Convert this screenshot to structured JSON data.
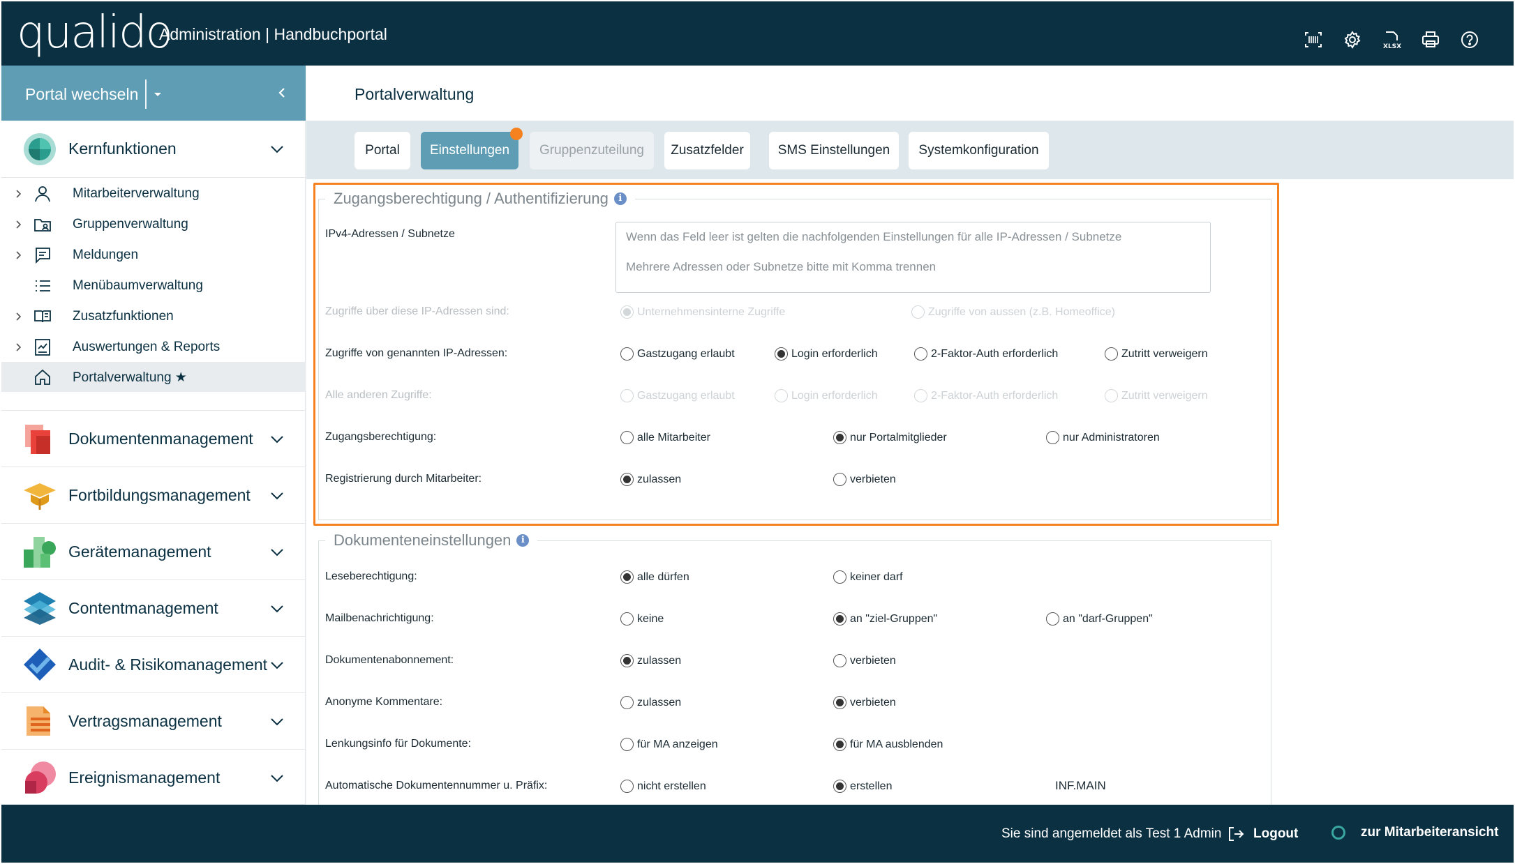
{
  "header": {
    "logo": "qualido",
    "app_title": "Administration | Handbuchportal",
    "icons": [
      "barcode-icon",
      "gear-icon",
      "xlsx-icon",
      "print-icon",
      "help-icon"
    ],
    "xlsx_text": "XLSX"
  },
  "sidebar": {
    "portal_switch": "Portal wechseln",
    "kern": {
      "title": "Kernfunktionen",
      "items": [
        {
          "label": "Mitarbeiterverwaltung",
          "icon": "user-icon",
          "expandable": true
        },
        {
          "label": "Gruppenverwaltung",
          "icon": "group-folder-icon",
          "expandable": true
        },
        {
          "label": "Meldungen",
          "icon": "message-icon",
          "expandable": true
        },
        {
          "label": "Menübaumverwaltung",
          "icon": "list-icon",
          "expandable": false
        },
        {
          "label": "Zusatzfunktionen",
          "icon": "book-icon",
          "expandable": true
        },
        {
          "label": "Auswertungen & Reports",
          "icon": "report-icon",
          "expandable": true
        },
        {
          "label": "Portalverwaltung ★",
          "icon": "home-icon",
          "expandable": false,
          "active": true
        }
      ]
    },
    "sections": [
      {
        "title": "Dokumentenmanagement",
        "icon": "documents-icon"
      },
      {
        "title": "Fortbildungsmanagement",
        "icon": "graduation-icon"
      },
      {
        "title": "Gerätemanagement",
        "icon": "devices-icon"
      },
      {
        "title": "Contentmanagement",
        "icon": "layers-icon"
      },
      {
        "title": "Audit- & Risikomanagement",
        "icon": "checkmark-icon"
      },
      {
        "title": "Vertragsmanagement",
        "icon": "contract-icon"
      },
      {
        "title": "Ereignismanagement",
        "icon": "events-icon"
      }
    ]
  },
  "main": {
    "title": "Portalverwaltung",
    "tabs": [
      {
        "label": "Portal"
      },
      {
        "label": "Einstellungen"
      },
      {
        "label": "Gruppenzuteilung"
      },
      {
        "label": "Zusatzfelder"
      },
      {
        "label": "SMS Einstellungen"
      },
      {
        "label": "Systemkonfiguration"
      }
    ],
    "active_tab": "Einstellungen",
    "access": {
      "legend": "Zugangsberechtigung / Authentifizierung",
      "ip_label": "IPv4-Adressen / Subnetze",
      "ip_placeholder_1": "Wenn das Feld leer ist gelten die nachfolgenden Einstellungen für alle IP-Adressen / Subnetze",
      "ip_placeholder_2": "Mehrere Adressen oder Subnetze bitte mit Komma trennen",
      "rows": {
        "ip_type": {
          "label": "Zugriffe über diese IP-Adressen sind:",
          "options": [
            "Unternehmensinterne Zugriffe",
            "Zugriffe von aussen (z.B. Homeoffice)"
          ],
          "selected": "Unternehmensinterne Zugriffe",
          "disabled": true
        },
        "named_ip": {
          "label": "Zugriffe von genannten IP-Adressen:",
          "options": [
            "Gastzugang erlaubt",
            "Login erforderlich",
            "2-Faktor-Auth erforderlich",
            "Zutritt verweigern"
          ],
          "selected": "Login erforderlich"
        },
        "other": {
          "label": "Alle anderen Zugriffe:",
          "options": [
            "Gastzugang erlaubt",
            "Login erforderlich",
            "2-Faktor-Auth erforderlich",
            "Zutritt verweigern"
          ],
          "disabled": true
        },
        "access_right": {
          "label": "Zugangsberechtigung:",
          "options": [
            "alle Mitarbeiter",
            "nur Portalmitglieder",
            "nur Administratoren"
          ],
          "selected": "nur Portalmitglieder"
        },
        "registration": {
          "label": "Registrierung durch Mitarbeiter:",
          "options": [
            "zulassen",
            "verbieten"
          ],
          "selected": "zulassen"
        }
      }
    },
    "docs": {
      "legend": "Dokumenteneinstellungen",
      "rows": {
        "read": {
          "label": "Leseberechtigung:",
          "options": [
            "alle dürfen",
            "keiner darf"
          ],
          "selected": "alle dürfen"
        },
        "mail": {
          "label": "Mailbenachrichtigung:",
          "options": [
            "keine",
            "an \"ziel-Gruppen\"",
            "an \"darf-Gruppen\""
          ],
          "selected": "an \"ziel-Gruppen\""
        },
        "subscription": {
          "label": "Dokumentenabonnement:",
          "options": [
            "zulassen",
            "verbieten"
          ],
          "selected": "zulassen"
        },
        "anon": {
          "label": "Anonyme Kommentare:",
          "options": [
            "zulassen",
            "verbieten"
          ],
          "selected": "verbieten"
        },
        "steering": {
          "label": "Lenkungsinfo für Dokumente:",
          "options": [
            "für MA anzeigen",
            "für MA ausblenden"
          ],
          "selected": "für MA ausblenden"
        },
        "autonum": {
          "label": "Automatische Dokumentennummer u. Präfix:",
          "options": [
            "nicht erstellen",
            "erstellen"
          ],
          "selected": "erstellen",
          "prefix": "INF.MAIN"
        }
      }
    }
  },
  "footer": {
    "logged_in_prefix": "Sie sind angemeldet als",
    "user": "Test 1 Admin",
    "logout": "Logout",
    "employee_view": "zur Mitarbeiteransicht"
  },
  "colors": {
    "navy": "#0a3042",
    "accent": "#5f9db4",
    "highlight": "#f5821f"
  }
}
